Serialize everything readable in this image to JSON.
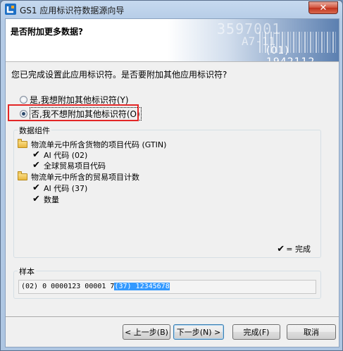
{
  "window": {
    "title": "GS1 应用标识符数据源向导",
    "close_label": "✕"
  },
  "header": {
    "title": "是否附加更多数据?",
    "banner_text_1": "3597001",
    "banner_text_2": "A7-11",
    "banner_text_3": "(01) 1942112"
  },
  "question": "您已完成设置此应用标识符。是否要附加其他应用标识符?",
  "options": {
    "yes_label": "是,我想附加其他标识符(Y)",
    "no_label": "否,我不想附加其他标识符(O)",
    "selected": "no"
  },
  "components": {
    "group_label": "数据组件",
    "items": [
      {
        "label": "物流单元中所含货物的项目代码 (GTIN)",
        "children": [
          "AI 代码 (02)",
          "全球贸易项目代码"
        ]
      },
      {
        "label": "物流单元中所含的贸易项目计数",
        "children": [
          "AI 代码 (37)",
          "数量"
        ]
      }
    ],
    "legend": "= 完成"
  },
  "sample": {
    "group_label": "样本",
    "text_plain": "(02) 0 0000123 00001 7",
    "text_selected": "(37) 12345678"
  },
  "buttons": {
    "back": "< 上一步(B)",
    "next": "下一步(N) >",
    "finish": "完成(F)",
    "cancel": "取消"
  }
}
